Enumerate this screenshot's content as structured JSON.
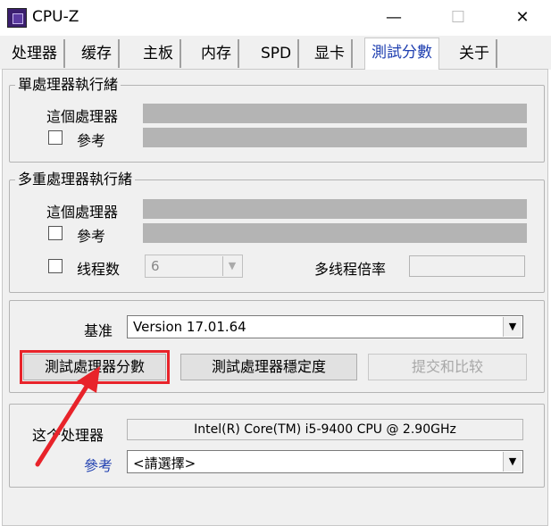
{
  "window": {
    "title": "CPU-Z",
    "controls": [
      "—",
      "☐",
      "✕"
    ]
  },
  "tabs": [
    "处理器",
    "缓存",
    "主板",
    "内存",
    "SPD",
    "显卡",
    "測試分數",
    "关于"
  ],
  "active_tab": "測試分數",
  "single_thread": {
    "legend": "單處理器執行緒",
    "this_cpu_label": "這個處理器",
    "reference_label": "參考"
  },
  "multi_thread": {
    "legend": "多重處理器執行緒",
    "this_cpu_label": "這個處理器",
    "reference_label": "參考",
    "threads_label": "线程数",
    "threads_value": "6",
    "ratio_label": "多线程倍率"
  },
  "benchmark": {
    "baseline_label": "基准",
    "baseline_value": "Version 17.01.64",
    "bench_cpu_button": "測試處理器分數",
    "stress_cpu_button": "測試處理器穩定度",
    "submit_button": "提交和比较"
  },
  "compare": {
    "this_cpu_label": "这个处理器",
    "this_cpu_value": "Intel(R) Core(TM) i5-9400 CPU @ 2.90GHz",
    "reference_label": "參考",
    "reference_value": "<請選擇>"
  },
  "annotation": {
    "color": "#e8232a"
  },
  "colors": {
    "active_tab": "#1f3fb0",
    "reference_link": "#1f3fb0"
  }
}
